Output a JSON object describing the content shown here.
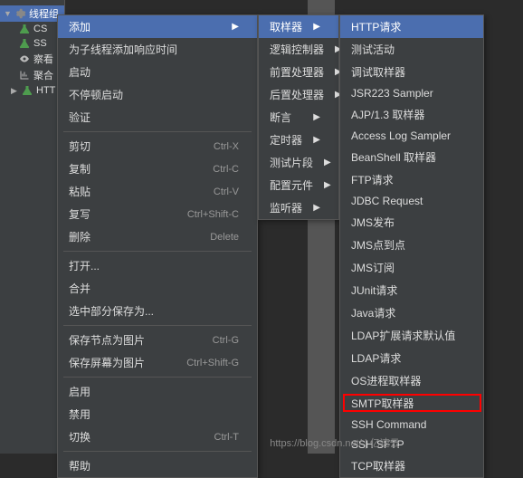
{
  "tree": {
    "root": "线程组",
    "items": [
      "CS",
      "SS",
      "察看",
      "聚合",
      "HTT"
    ]
  },
  "menu1": {
    "add": "添加",
    "add_think_time": "为子线程添加响应时间",
    "start": "启动",
    "start_no_pause": "不停顿启动",
    "validate": "验证",
    "cut": "剪切",
    "copy": "复制",
    "paste": "粘贴",
    "duplicate": "复写",
    "delete": "删除",
    "open": "打开...",
    "merge": "合并",
    "save_selection_as": "选中部分保存为...",
    "save_node_as_image": "保存节点为图片",
    "save_screen_as_image": "保存屏幕为图片",
    "enable": "启用",
    "disable": "禁用",
    "switch": "切换",
    "help": "帮助",
    "shortcuts": {
      "cut": "Ctrl-X",
      "copy": "Ctrl-C",
      "paste": "Ctrl-V",
      "duplicate": "Ctrl+Shift-C",
      "delete": "Delete",
      "save_node_as_image": "Ctrl-G",
      "save_screen_as_image": "Ctrl+Shift-G",
      "switch": "Ctrl-T"
    }
  },
  "menu2": {
    "sampler": "取样器",
    "logic_controller": "逻辑控制器",
    "pre_processor": "前置处理器",
    "post_processor": "后置处理器",
    "assertion": "断言",
    "timer": "定时器",
    "test_fragment": "测试片段",
    "config_element": "配置元件",
    "listener": "监听器"
  },
  "menu3": {
    "items": [
      "HTTP请求",
      "测试活动",
      "调试取样器",
      "JSR223 Sampler",
      "AJP/1.3 取样器",
      "Access Log Sampler",
      "BeanShell 取样器",
      "FTP请求",
      "JDBC Request",
      "JMS发布",
      "JMS点到点",
      "JMS订阅",
      "JUnit请求",
      "Java请求",
      "LDAP扩展请求默认值",
      "LDAP请求",
      "OS进程取样器",
      "SMTP取样器",
      "SSH Command",
      "SSH SFTP",
      "TCP取样器"
    ]
  },
  "watermark": "https://blog.csdn.net/ | 亿速云"
}
